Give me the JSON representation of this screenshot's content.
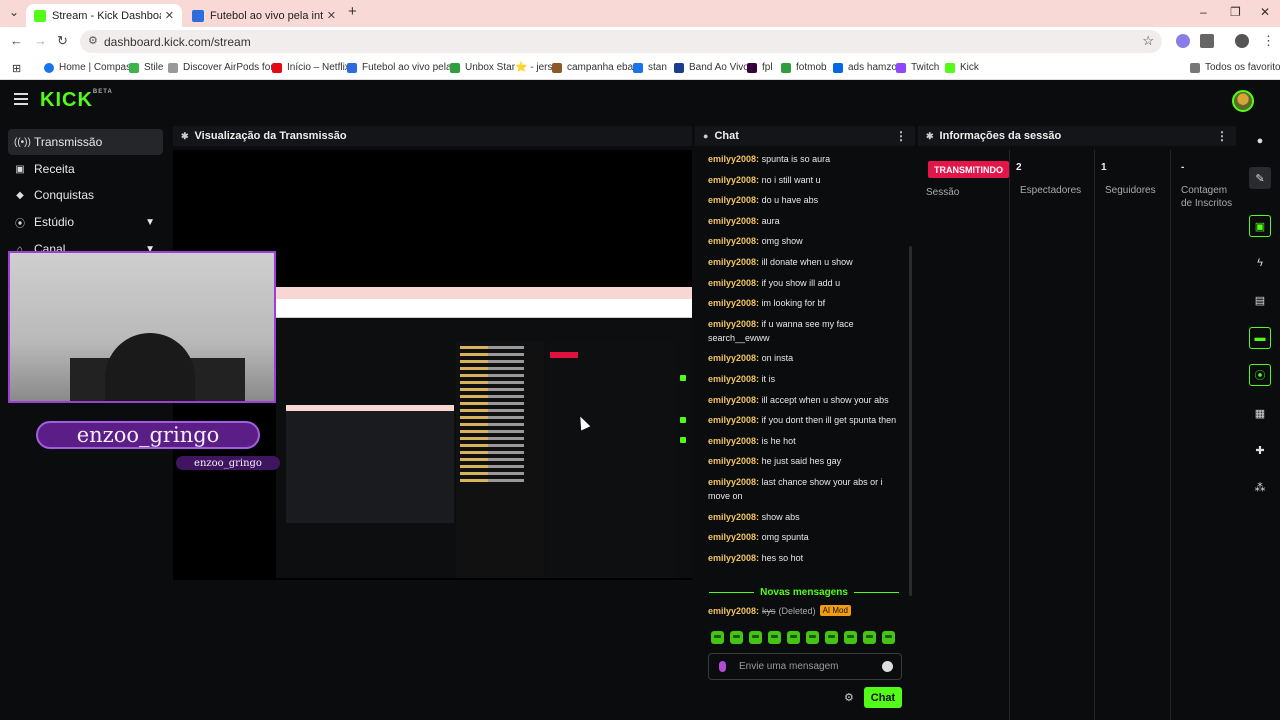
{
  "browser": {
    "tabs": [
      {
        "title": "Stream - Kick Dashboard",
        "active": true,
        "favicon_color": "#53fc18"
      },
      {
        "title": "Futebol ao vivo pela internet - F",
        "active": false,
        "favicon_color": "#2d6cdf"
      }
    ],
    "url": "dashboard.kick.com/stream",
    "bookmarks": [
      {
        "label": "Home | Compass",
        "color": "#1a73e8"
      },
      {
        "label": "Stile",
        "color": "#3cb44b"
      },
      {
        "label": "Discover AirPods for...",
        "color": "#999999"
      },
      {
        "label": "Início – Netflix",
        "color": "#e50914"
      },
      {
        "label": "Futebol ao vivo pela...",
        "color": "#2d6cdf"
      },
      {
        "label": "Unbox Star⭐ - jers...",
        "color": "#2e9e3e"
      },
      {
        "label": "campanha ebay",
        "color": "#8a5a2b"
      },
      {
        "label": "stan",
        "color": "#1a73e8"
      },
      {
        "label": "Band Ao Vivo",
        "color": "#1a3d8f"
      },
      {
        "label": "fpl",
        "color": "#37003c"
      },
      {
        "label": "fotmob",
        "color": "#2e9e3e"
      },
      {
        "label": "ads hamzo",
        "color": "#0668e1"
      },
      {
        "label": "Twitch",
        "color": "#9146ff"
      },
      {
        "label": "Kick",
        "color": "#53fc18"
      }
    ],
    "bookmarks_folder": "Todos os favoritos"
  },
  "kick": {
    "logo": "KICK",
    "logo_tag": "BETA",
    "brand_color": "#53fc18"
  },
  "sidebar": {
    "items": [
      {
        "label": "Transmissão",
        "icon": "broadcast-icon",
        "active": true
      },
      {
        "label": "Receita",
        "icon": "revenue-icon"
      },
      {
        "label": "Conquistas",
        "icon": "trophy-icon"
      },
      {
        "label": "Estúdio",
        "icon": "studio-icon",
        "expandable": true
      },
      {
        "label": "Canal",
        "icon": "channel-icon",
        "expandable": true
      }
    ]
  },
  "preview": {
    "title": "Visualização da Transmissão",
    "overlay_name": "enzoo_gringo",
    "overlay_name_small": "enzoo_gringo"
  },
  "chat": {
    "title": "Chat",
    "messages": [
      {
        "user": "emilyy2008:",
        "text": "spunta is so aura"
      },
      {
        "user": "emilyy2008:",
        "text": "no i still want u"
      },
      {
        "user": "emilyy2008:",
        "text": "do u have abs"
      },
      {
        "user": "emilyy2008:",
        "text": "aura"
      },
      {
        "user": "emilyy2008:",
        "text": "omg show"
      },
      {
        "user": "emilyy2008:",
        "text": "ill donate when u show"
      },
      {
        "user": "emilyy2008:",
        "text": "if you show ill add u"
      },
      {
        "user": "emilyy2008:",
        "text": "im looking for bf"
      },
      {
        "user": "emilyy2008:",
        "text": "if u wanna see my face search__ewww"
      },
      {
        "user": "emilyy2008:",
        "text": "on insta"
      },
      {
        "user": "emilyy2008:",
        "text": "it is"
      },
      {
        "user": "emilyy2008:",
        "text": "ill accept when u show your abs"
      },
      {
        "user": "emilyy2008:",
        "text": "if you dont then ill get spunta then"
      },
      {
        "user": "emilyy2008:",
        "text": "is he hot"
      },
      {
        "user": "emilyy2008:",
        "text": "he just said hes gay"
      },
      {
        "user": "emilyy2008:",
        "text": "last chance show your abs or i move on"
      },
      {
        "user": "emilyy2008:",
        "text": "show abs"
      },
      {
        "user": "emilyy2008:",
        "text": "omg spunta"
      },
      {
        "user": "emilyy2008:",
        "text": "hes so hot"
      }
    ],
    "new_messages_label": "Novas mensagens",
    "deleted": {
      "user": "emilyy2008:",
      "text": "kys",
      "deleted_label": "(Deleted)",
      "mod_badge": "AI Mod"
    },
    "input_placeholder": "Envie uma mensagem",
    "send_label": "Chat"
  },
  "session": {
    "title": "Informações da sessão",
    "live_badge": "TRANSMITINDO",
    "session_label": "Sessão",
    "stats": [
      {
        "value": "2",
        "label": "Espectadores"
      },
      {
        "value": "1",
        "label": "Seguidores"
      },
      {
        "value": "-",
        "label": "Contagem de Inscritos"
      }
    ]
  }
}
